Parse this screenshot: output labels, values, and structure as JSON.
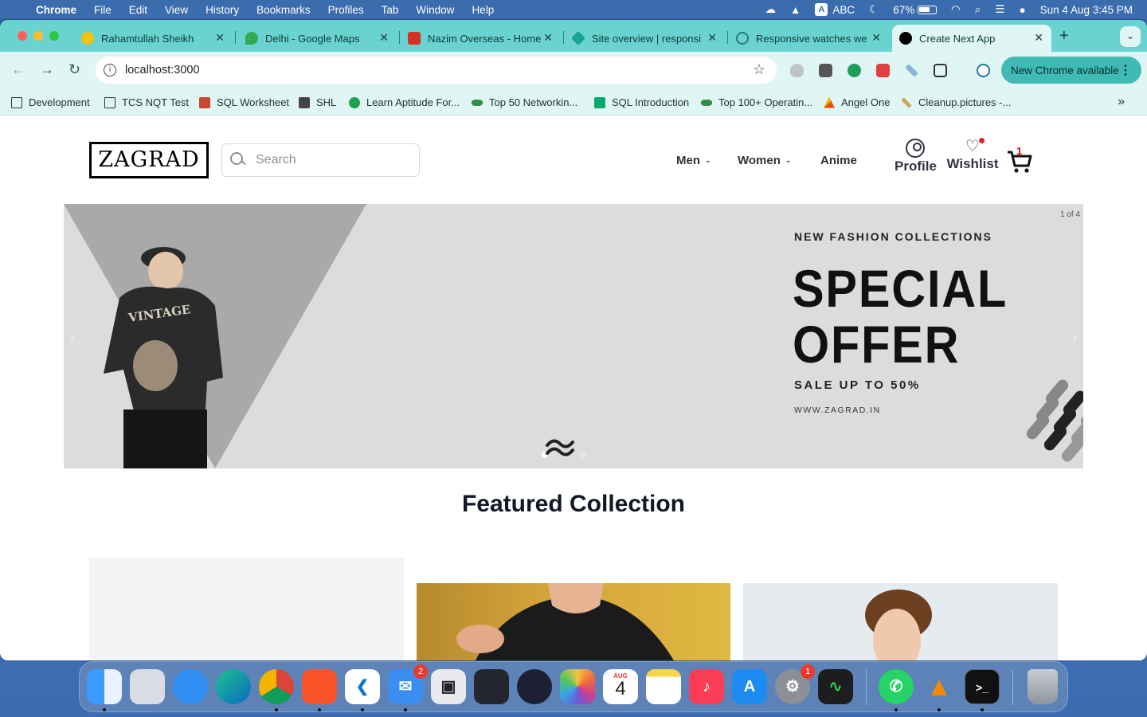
{
  "menubar": {
    "app": "Chrome",
    "items": [
      "File",
      "Edit",
      "View",
      "History",
      "Bookmarks",
      "Profiles",
      "Tab",
      "Window",
      "Help"
    ],
    "input_source": "ABC",
    "battery": "67%",
    "datetime": "Sun 4 Aug  3:45 PM"
  },
  "tabs": [
    {
      "title": "Rahamtullah Sheikh",
      "color": "#f4c20d"
    },
    {
      "title": "Delhi - Google Maps",
      "color": "#34a853"
    },
    {
      "title": "Nazim Overseas - Home",
      "color": "#d93025"
    },
    {
      "title": "Site overview | responsi",
      "color": "#17a398"
    },
    {
      "title": "Responsive watches we",
      "color": "#2b7a78"
    },
    {
      "title": "Create Next App",
      "color": "#000000"
    }
  ],
  "toolbar": {
    "url": "localhost:3000",
    "chrome_available": "New Chrome available"
  },
  "bookmarks": [
    {
      "label": "Development",
      "icon": "folder-icon"
    },
    {
      "label": "TCS NQT Test",
      "icon": "folder-icon"
    },
    {
      "label": "SQL Worksheet",
      "icon": "oracle-icon"
    },
    {
      "label": "SHL",
      "icon": "shl-icon"
    },
    {
      "label": "Learn Aptitude For...",
      "icon": "play-icon"
    },
    {
      "label": "Top 50 Networkin...",
      "icon": "gfg-icon"
    },
    {
      "label": "SQL Introduction",
      "icon": "w3-icon"
    },
    {
      "label": "Top 100+ Operatin...",
      "icon": "gfg-icon"
    },
    {
      "label": "Angel One",
      "icon": "angel-icon"
    },
    {
      "label": "Cleanup.pictures -...",
      "icon": "wand-icon"
    }
  ],
  "site": {
    "logo": "ZAGRAD",
    "search_placeholder": "Search",
    "nav": {
      "men": "Men",
      "women": "Women",
      "anime": "Anime"
    },
    "profile": "Profile",
    "wishlist": "Wishlist",
    "cart_count": "1"
  },
  "hero": {
    "counter": "1 of 4",
    "kicker": "NEW FASHION COLLECTIONS",
    "title_line1": "SPECIAL",
    "title_line2": "OFFER",
    "sale": "SALE UP TO 50%",
    "website": "WWW.ZAGRAD.IN",
    "shirt_text": "VINTAGE",
    "slides_total": 3,
    "active_slide": 1
  },
  "featured": {
    "title": "Featured Collection"
  },
  "dock": {
    "apps": [
      "Finder",
      "Launchpad",
      "Safari",
      "Edge",
      "Chrome",
      "Brave",
      "VS Code",
      "Mail",
      "Screenshot",
      "DaVinci Resolve",
      "OBS",
      "Photos",
      "Calendar",
      "Notes",
      "Music",
      "App Store",
      "System Settings",
      "Activity Monitor",
      "WhatsApp",
      "VLC",
      "Terminal",
      "Trash"
    ],
    "mail_badge": "2",
    "settings_badge": "1",
    "calendar_month": "AUG",
    "calendar_day": "4"
  }
}
